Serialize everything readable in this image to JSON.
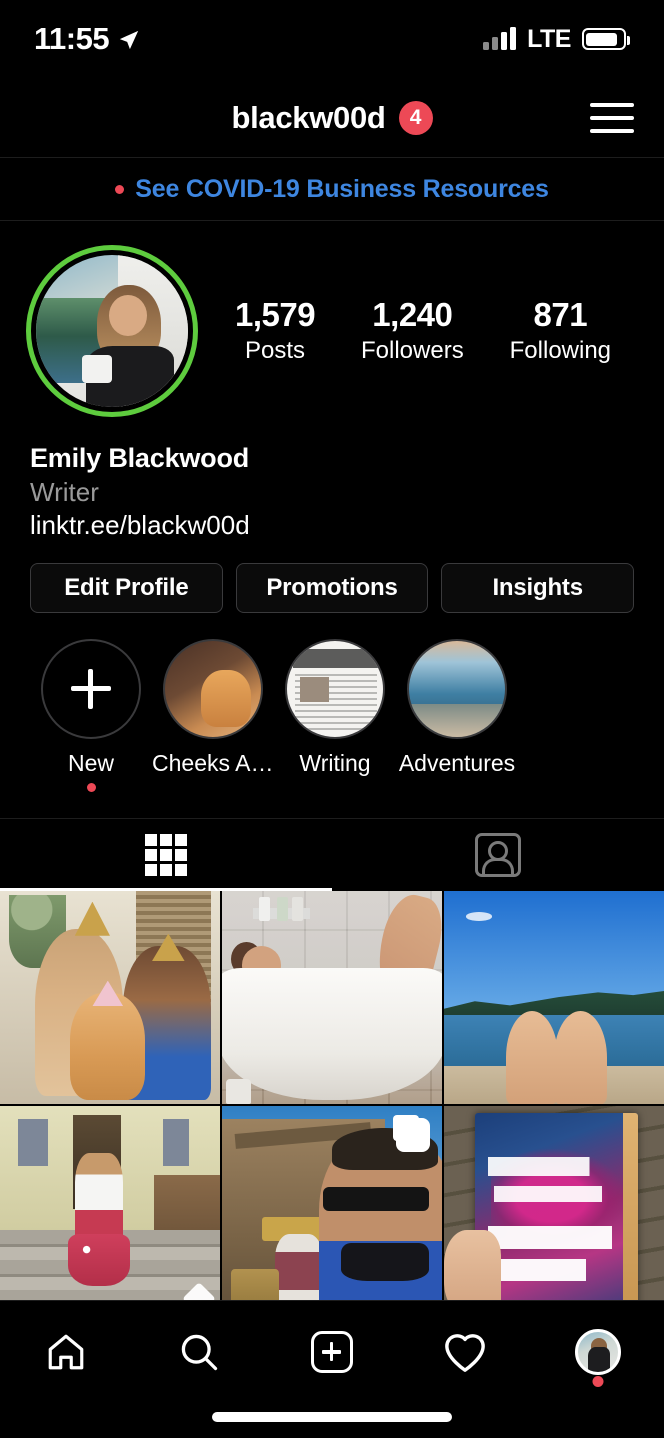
{
  "status_bar": {
    "time": "11:55",
    "location_icon": "location-arrow-icon",
    "carrier_label": "LTE",
    "signal_icon": "signal-bars-icon",
    "battery_icon": "battery-icon"
  },
  "nav_header": {
    "username": "blackw00d",
    "badge_count": "4",
    "badge_color": "#ED4956",
    "menu_icon": "hamburger-menu-icon"
  },
  "banner": {
    "text": "See COVID-19 Business Resources",
    "link_color": "#3E86E0",
    "dot_color": "#ED4956"
  },
  "profile": {
    "avatar_ring_color": "#5ECC3E",
    "avatar_alt": "woman holding white mug outdoors",
    "stats": [
      {
        "value": "1,579",
        "label": "Posts"
      },
      {
        "value": "1,240",
        "label": "Followers"
      },
      {
        "value": "871",
        "label": "Following"
      }
    ],
    "full_name": "Emily Blackwood",
    "category": "Writer",
    "link": "linktr.ee/blackw00d"
  },
  "actions": [
    {
      "label": "Edit Profile"
    },
    {
      "label": "Promotions"
    },
    {
      "label": "Insights"
    }
  ],
  "highlights": [
    {
      "label": "New",
      "kind": "new",
      "has_dot": true
    },
    {
      "label": "Cheeks An...",
      "kind": "cat",
      "has_dot": false
    },
    {
      "label": "Writing",
      "kind": "writing",
      "has_dot": false
    },
    {
      "label": "Adventures",
      "kind": "adv",
      "has_dot": false
    }
  ],
  "tabs": [
    {
      "name": "grid-tab",
      "icon": "grid-icon",
      "active": true
    },
    {
      "name": "tagged-tab",
      "icon": "tagged-icon",
      "active": false
    }
  ],
  "posts": [
    {
      "alt": "couple wearing party hats holding an orange cat",
      "overlay": "none"
    },
    {
      "alt": "woman relaxing in a white bathtub with leg raised",
      "overlay": "none"
    },
    {
      "alt": "knees in foreground at a blue mountain lake",
      "overlay": "none"
    },
    {
      "alt": "woman in white top and red floral skirt on porch steps",
      "overlay": "carousel-bottom"
    },
    {
      "alt": "man in sunglasses and face mask at old west general mercantile",
      "overlay": "carousel-top"
    },
    {
      "alt": "hand holding book City of Girls by Elizabeth Gilbert",
      "overlay": "none"
    }
  ],
  "bottom_nav": [
    {
      "name": "home-tab",
      "icon": "home-icon",
      "has_dot": false
    },
    {
      "name": "search-tab",
      "icon": "search-icon",
      "has_dot": false
    },
    {
      "name": "create-tab",
      "icon": "plus-square-icon",
      "has_dot": false
    },
    {
      "name": "activity-tab",
      "icon": "heart-icon",
      "has_dot": false
    },
    {
      "name": "profile-tab",
      "icon": "avatar-icon",
      "has_dot": true
    }
  ]
}
